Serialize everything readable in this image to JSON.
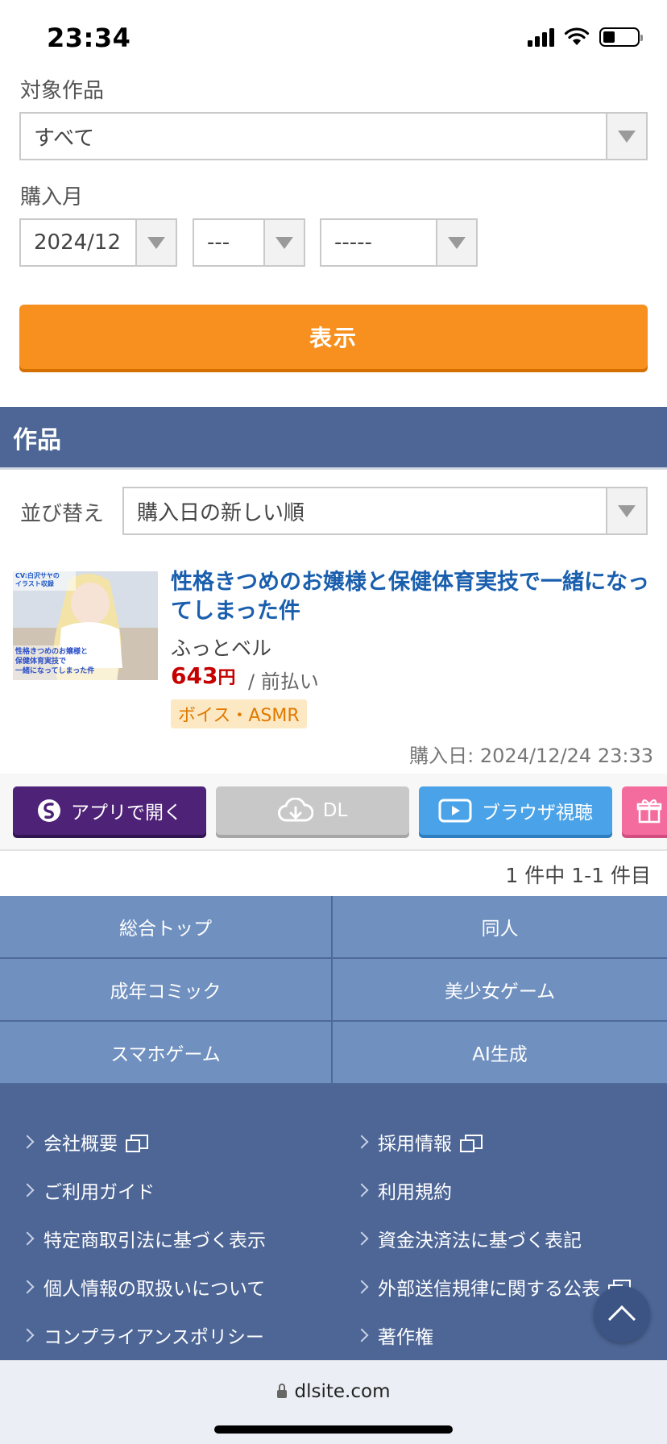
{
  "status_bar": {
    "time": "23:34"
  },
  "filters": {
    "work_label": "対象作品",
    "work_value": "すべて",
    "month_label": "購入月",
    "month_value": "2024/12",
    "second_value": "---",
    "third_value": "-----",
    "show_button": "表示"
  },
  "section": {
    "title": "作品"
  },
  "sort": {
    "label": "並び替え",
    "value": "購入日の新しい順"
  },
  "product": {
    "title": "性格きつめのお嬢様と保健体育実技で一緒になってしまった件",
    "maker": "ふっとベル",
    "price": "643",
    "price_unit": "円",
    "payment": "/ 前払い",
    "genre": "ボイス・ASMR",
    "purchase_date": "購入日: 2024/12/24 23:33",
    "thumb_text_top": "CV:白沢サヤの\nイラスト収録",
    "thumb_text_bottom": "性格きつめのお嬢様と\n保健体育実技で\n一緒になってしまった件"
  },
  "actions": {
    "app_open": "アプリで開く",
    "download": "DL",
    "browser_view": "ブラウザ視聴"
  },
  "result_count": "1 件中 1-1 件目",
  "categories": [
    "総合トップ",
    "同人",
    "成年コミック",
    "美少女ゲーム",
    "スマホゲーム",
    "AI生成"
  ],
  "footer_links": {
    "left": [
      "会社概要",
      "ご利用ガイド",
      "特定商取引法に基づく表示",
      "個人情報の取扱いについて",
      "コンプライアンスポリシー"
    ],
    "right": [
      "採用情報",
      "利用規約",
      "資金決済法に基づく表記",
      "外部送信規律に関する公表",
      "著作権"
    ]
  },
  "browser": {
    "url": "dlsite.com"
  },
  "colors": {
    "accent_orange": "#f7901e",
    "header_blue": "#4d6696",
    "category_blue": "#7090bf",
    "title_blue": "#1a5fae",
    "price_red": "#c40000",
    "app_purple": "#4e2277",
    "browser_blue": "#4aa3e8",
    "gift_pink": "#f46b9e"
  }
}
